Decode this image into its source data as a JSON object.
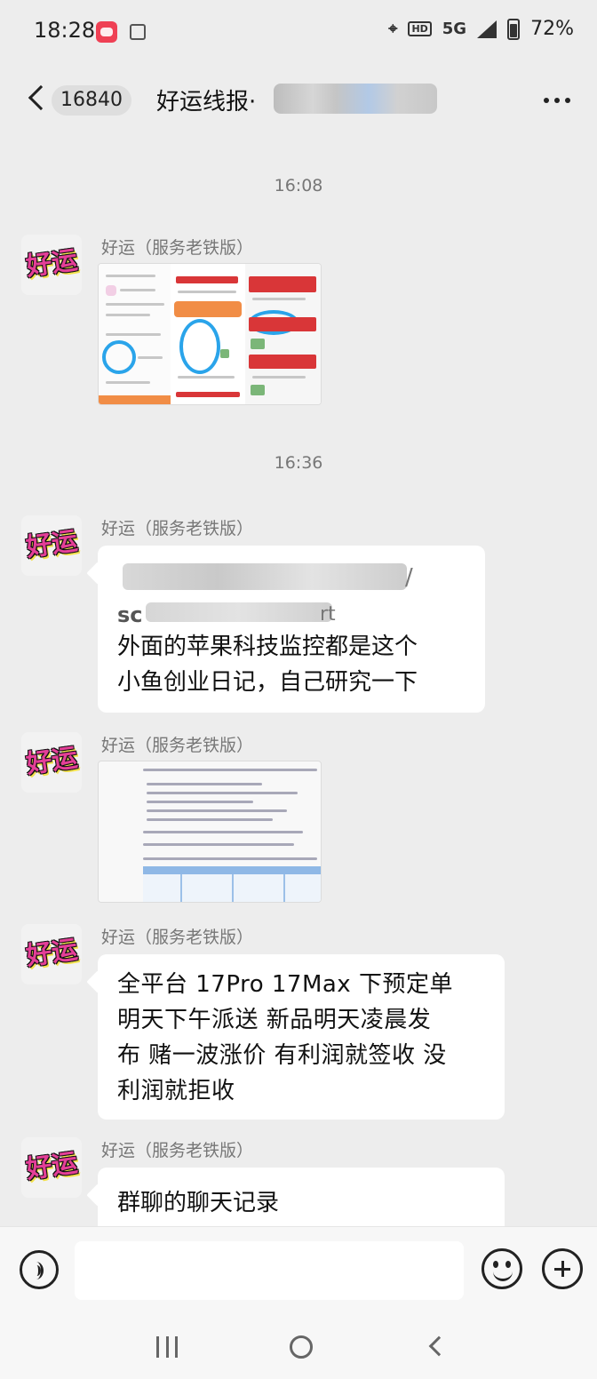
{
  "status_bar": {
    "time": "18:28",
    "hd_label": "HD",
    "network": "5G",
    "battery": "72%"
  },
  "header": {
    "unread_count": "16840",
    "title": "好运线报·"
  },
  "timestamps": [
    "16:08",
    "16:36"
  ],
  "messages": [
    {
      "type": "image",
      "sender": "好运（服务老铁版）",
      "avatar_text": "好运",
      "image_kind": "phone-screenshot-collage"
    },
    {
      "type": "link_text",
      "sender": "好运（服务老铁版）",
      "avatar_text": "好运",
      "link_fragment_end": "/",
      "link_fragment_start": "sc",
      "link_fragment_tail": "rt",
      "text": "外面的苹果科技监控都是这个\n小鱼创业日记，自己研究一下"
    },
    {
      "type": "image",
      "sender": "好运（服务老铁版）",
      "avatar_text": "好运",
      "image_kind": "document-screenshot"
    },
    {
      "type": "text",
      "sender": "好运（服务老铁版）",
      "avatar_text": "好运",
      "text": "全平台 17Pro 17Max 下预定单\n明天下午派送 新品明天凌晨发\n布 赌一波涨价 有利润就签收 没\n利润就拒收"
    },
    {
      "type": "text",
      "sender": "好运（服务老铁版）",
      "avatar_text": "好运",
      "text": "群聊的聊天记录"
    }
  ],
  "input_bar": {
    "placeholder": ""
  },
  "icons": {
    "back": "back-arrow-icon",
    "more": "more-icon",
    "voice": "voice-icon",
    "emoji": "emoji-icon",
    "plus": "plus-icon"
  }
}
